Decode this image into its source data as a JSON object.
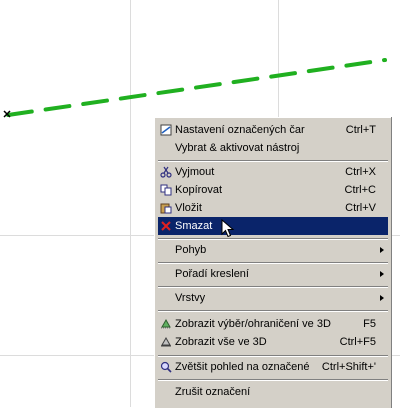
{
  "colors": {
    "line": "#20b020",
    "menu_bg": "#d4d0c8",
    "highlight": "#0a246a"
  },
  "menu": {
    "items": [
      {
        "label": "Nastavení označených čar",
        "shortcut": "Ctrl+T",
        "icon": "line-settings-icon"
      },
      {
        "label": "Vybrat & aktivovat nástroj",
        "shortcut": "",
        "icon": ""
      },
      {
        "label": "Vyjmout",
        "shortcut": "Ctrl+X",
        "icon": "scissors-icon"
      },
      {
        "label": "Kopírovat",
        "shortcut": "Ctrl+C",
        "icon": "copy-icon"
      },
      {
        "label": "Vložit",
        "shortcut": "Ctrl+V",
        "icon": "paste-icon"
      },
      {
        "label": "Smazat",
        "shortcut": "",
        "icon": "delete-x-icon"
      },
      {
        "label": "Pohyb",
        "shortcut": "",
        "icon": ""
      },
      {
        "label": "Pořadí kreslení",
        "shortcut": "",
        "icon": ""
      },
      {
        "label": "Vrstvy",
        "shortcut": "",
        "icon": ""
      },
      {
        "label": "Zobrazit výběr/ohraničení ve 3D",
        "shortcut": "F5",
        "icon": "3d-selection-icon"
      },
      {
        "label": "Zobrazit vše ve 3D",
        "shortcut": "Ctrl+F5",
        "icon": "3d-all-icon"
      },
      {
        "label": "Zvětšit pohled na označené",
        "shortcut": "Ctrl+Shift+'",
        "icon": "zoom-selection-icon"
      },
      {
        "label": "Zrušit označení",
        "shortcut": "",
        "icon": ""
      }
    ]
  }
}
